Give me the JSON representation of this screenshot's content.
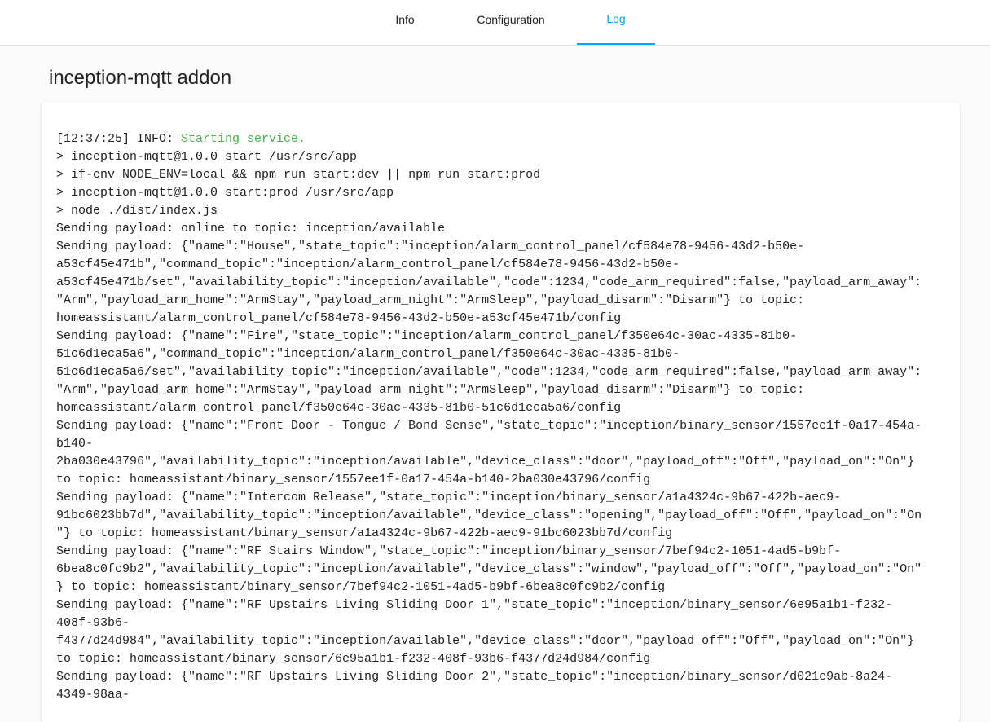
{
  "tabs": [
    {
      "label": "Info",
      "active": false
    },
    {
      "label": "Configuration",
      "active": false
    },
    {
      "label": "Log",
      "active": true
    }
  ],
  "accent_color": "#03a9f4",
  "success_color": "#4caf50",
  "page_title": "inception-mqtt addon",
  "log": {
    "first_line_prefix": "[12:37:25] INFO: ",
    "first_line_status": "Starting service.",
    "lines": [
      "> inception-mqtt@1.0.0 start /usr/src/app",
      "> if-env NODE_ENV=local && npm run start:dev || npm run start:prod",
      "> inception-mqtt@1.0.0 start:prod /usr/src/app",
      "> node ./dist/index.js",
      "Sending payload: online to topic: inception/available",
      "Sending payload: {\"name\":\"House\",\"state_topic\":\"inception/alarm_control_panel/cf584e78-9456-43d2-b50e-",
      "a53cf45e471b\",\"command_topic\":\"inception/alarm_control_panel/cf584e78-9456-43d2-b50e-",
      "a53cf45e471b/set\",\"availability_topic\":\"inception/available\",\"code\":1234,\"code_arm_required\":false,\"payload_arm_away\":",
      "\"Arm\",\"payload_arm_home\":\"ArmStay\",\"payload_arm_night\":\"ArmSleep\",\"payload_disarm\":\"Disarm\"} to topic:",
      "homeassistant/alarm_control_panel/cf584e78-9456-43d2-b50e-a53cf45e471b/config",
      "Sending payload: {\"name\":\"Fire\",\"state_topic\":\"inception/alarm_control_panel/f350e64c-30ac-4335-81b0-",
      "51c6d1eca5a6\",\"command_topic\":\"inception/alarm_control_panel/f350e64c-30ac-4335-81b0-",
      "51c6d1eca5a6/set\",\"availability_topic\":\"inception/available\",\"code\":1234,\"code_arm_required\":false,\"payload_arm_away\":",
      "\"Arm\",\"payload_arm_home\":\"ArmStay\",\"payload_arm_night\":\"ArmSleep\",\"payload_disarm\":\"Disarm\"} to topic:",
      "homeassistant/alarm_control_panel/f350e64c-30ac-4335-81b0-51c6d1eca5a6/config",
      "Sending payload: {\"name\":\"Front Door - Tongue / Bond Sense\",\"state_topic\":\"inception/binary_sensor/1557ee1f-0a17-454a-",
      "b140-",
      "2ba030e43796\",\"availability_topic\":\"inception/available\",\"device_class\":\"door\",\"payload_off\":\"Off\",\"payload_on\":\"On\"}",
      "to topic: homeassistant/binary_sensor/1557ee1f-0a17-454a-b140-2ba030e43796/config",
      "Sending payload: {\"name\":\"Intercom Release\",\"state_topic\":\"inception/binary_sensor/a1a4324c-9b67-422b-aec9-",
      "91bc6023bb7d\",\"availability_topic\":\"inception/available\",\"device_class\":\"opening\",\"payload_off\":\"Off\",\"payload_on\":\"On",
      "\"} to topic: homeassistant/binary_sensor/a1a4324c-9b67-422b-aec9-91bc6023bb7d/config",
      "Sending payload: {\"name\":\"RF Stairs Window\",\"state_topic\":\"inception/binary_sensor/7bef94c2-1051-4ad5-b9bf-",
      "6bea8c0fc9b2\",\"availability_topic\":\"inception/available\",\"device_class\":\"window\",\"payload_off\":\"Off\",\"payload_on\":\"On\"",
      "} to topic: homeassistant/binary_sensor/7bef94c2-1051-4ad5-b9bf-6bea8c0fc9b2/config",
      "Sending payload: {\"name\":\"RF Upstairs Living Sliding Door 1\",\"state_topic\":\"inception/binary_sensor/6e95a1b1-f232-",
      "408f-93b6-",
      "f4377d24d984\",\"availability_topic\":\"inception/available\",\"device_class\":\"door\",\"payload_off\":\"Off\",\"payload_on\":\"On\"}",
      "to topic: homeassistant/binary_sensor/6e95a1b1-f232-408f-93b6-f4377d24d984/config",
      "Sending payload: {\"name\":\"RF Upstairs Living Sliding Door 2\",\"state_topic\":\"inception/binary_sensor/d021e9ab-8a24-",
      "4349-98aa-"
    ]
  }
}
